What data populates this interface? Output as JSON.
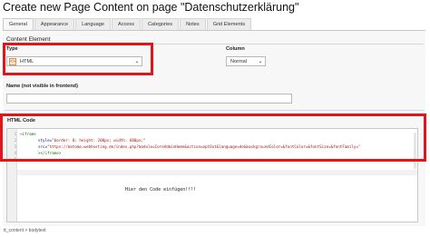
{
  "title": "Create new Page Content on page \"Datenschutzerklärung\"",
  "tabs": [
    {
      "label": "General"
    },
    {
      "label": "Appearance"
    },
    {
      "label": "Language"
    },
    {
      "label": "Access"
    },
    {
      "label": "Categories"
    },
    {
      "label": "Notes"
    },
    {
      "label": "Grid Elements"
    }
  ],
  "section_label": "Content Element",
  "type_field": {
    "label": "Type",
    "value": "HTML"
  },
  "column_field": {
    "label": "Column",
    "value": "Normal"
  },
  "name_field": {
    "label": "Name (not visible in frontend)",
    "value": ""
  },
  "html_code": {
    "label": "HTML Code",
    "line_numbers": [
      "1",
      "2",
      "3",
      "4",
      "5"
    ],
    "line1": "<iframe",
    "line2_attr": "style=",
    "line2_val": "\"border: 0; height: 200px; width: 600px;\"",
    "line3_attr": "src=",
    "line3_val": "\"https://matomo.webhosting.de/index.php?module=CoreAdminHome&action=optOut&language=de&backgroundColor=&fontColor=&fontSize=&fontFamily=\"",
    "line4": "></iframe>",
    "placeholder_text": "Hier den Code einfügen!!!!"
  },
  "footer_path": "tt_content > bodytext",
  "colors": {
    "highlight": "#e5141b"
  }
}
